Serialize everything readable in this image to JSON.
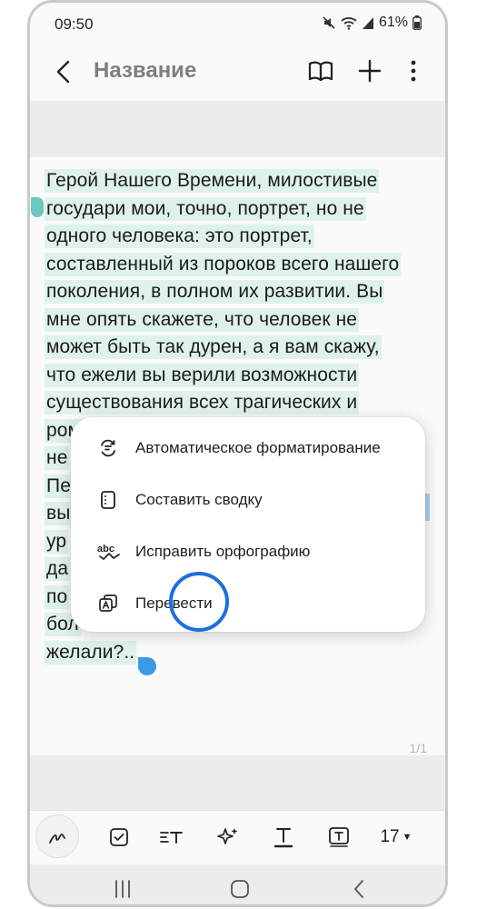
{
  "status_bar": {
    "time": "09:50",
    "battery": "61%",
    "icons": [
      "mute-icon",
      "wifi-icon",
      "signal-icon",
      "battery-icon"
    ]
  },
  "header": {
    "title": "Название",
    "icons": [
      "back-arrow-icon",
      "book-icon",
      "plus-icon",
      "more-vert-icon"
    ]
  },
  "note": {
    "line_1": "Герой Нашего Времени, милостивые",
    "line_2": "государи мои, точно, портрет, но не",
    "line_3": "одного человека: это портрет,",
    "line_4": "составленный из пороков всего нашего",
    "line_5": "поколения, в полном их развитии. Вы",
    "line_6": "мне опять скажете, что человек не",
    "line_7": "может быть так дурен, а я вам скажу,",
    "line_8": "что ежели вы верили возможности",
    "line_9": "существования всех трагических и",
    "line_10": "ром",
    "line_11": "не",
    "line_12": "Пе",
    "line_13": "вы",
    "line_14": "ур",
    "line_15": "да",
    "line_16": "по",
    "line_17": "бол",
    "line_18": "желали?.."
  },
  "context_menu": {
    "items": [
      {
        "label": "Автоматическое форматирование",
        "icon": "auto-format-icon"
      },
      {
        "label": "Составить сводку",
        "icon": "summary-icon"
      },
      {
        "label": "Исправить орфографию",
        "icon": "spellcheck-icon"
      },
      {
        "label": "Перевести",
        "icon": "translate-icon"
      }
    ]
  },
  "page_counter": "1/1",
  "toolbar": {
    "font_size": "17",
    "icons": [
      "pen-icon",
      "checkbox-icon",
      "text-style-icon",
      "sparkle-ai-icon",
      "underline-text-icon",
      "text-box-icon"
    ]
  },
  "nav": {
    "icons": [
      "recents-icon",
      "home-icon",
      "back-icon"
    ]
  },
  "colors": {
    "highlight": "#dff2ea",
    "handle_start": "#6cc8c0",
    "handle_end": "#3b99e8",
    "tap_ring": "#1d6fe0",
    "title_gray": "#7f7f7f"
  }
}
